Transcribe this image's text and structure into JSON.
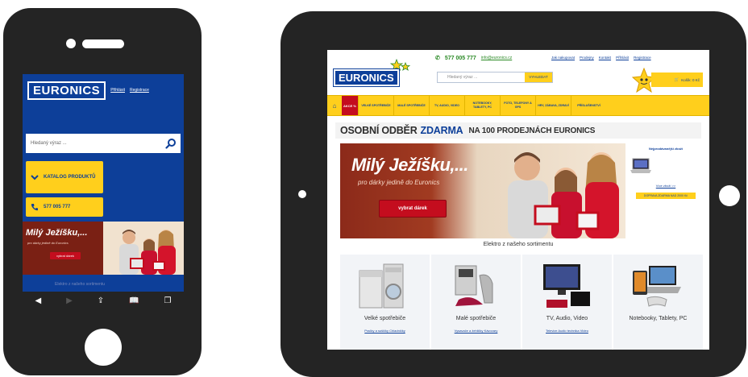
{
  "phone": {
    "logo": "EURONICS",
    "links": [
      "Přihlásit",
      "Registrace"
    ],
    "search_placeholder": "Hledaný výraz ...",
    "catalog_button": "KATALOG PRODUKTŮ",
    "phone_button": "577 005 777",
    "banner": {
      "title": "Milý Ježíšku,...",
      "subtitle": "pro dárky jedině do Euronics",
      "button": "vybrat dárek"
    },
    "blurred_footer": "Elektro z našeho sortimentu",
    "toolbar_icons": [
      "back-icon",
      "forward-icon",
      "share-icon",
      "bookmarks-icon",
      "tabs-icon"
    ]
  },
  "tablet": {
    "logo": "EURONICS",
    "phone": "577 005 777",
    "email": "info@euronics.cz",
    "top_links": [
      "Jak nakupovat",
      "Prodejny",
      "Kontakt",
      "Přihlásit",
      "Registrace"
    ],
    "search_placeholder": "Hledaný výraz ...",
    "search_button": "VYHLEDAT",
    "cart": "Košík: 0 Kč",
    "nav_sale": "AKCE %",
    "nav": [
      "VELKÉ SPOTŘEBIČE",
      "MALÉ SPOTŘEBIČE",
      "TV, AUDIO, VIDEO",
      "NOTEBOOKY, TABLETY, PC",
      "FOTO, TELEFONY A GPS",
      "HRY, ZÁBAVA, ZDRAVÍ",
      "PŘÍSLUŠENSTVÍ"
    ],
    "promo": {
      "lead": "OSOBNÍ ODBĚR",
      "highlight": "ZDARMA",
      "rest": "NA 100 PRODEJNÁCH EURONICS"
    },
    "hero": {
      "title": "Milý Ježíšku,...",
      "subtitle": "pro dárky jedině do Euronics",
      "button": "vybrat dárek"
    },
    "side": {
      "title": "Nejprodávanější zboží",
      "link": "Více zboží >>",
      "button": "DOPRAVA ZDARMA NAD 2000 Kč"
    },
    "range_title": "Elektro z našeho sortimentu",
    "categories": [
      {
        "label": "Velké spotřebiče",
        "sub": "Pračky a sušičky  Chladničky"
      },
      {
        "label": "Malé spotřebiče",
        "sub": "Vysavače a žehličky  Kávovary"
      },
      {
        "label": "TV, Audio, Video",
        "sub": "Televize  Audio technika  Video"
      },
      {
        "label": "Notebooky, Tablety, PC",
        "sub": ""
      }
    ]
  },
  "colors": {
    "brand_blue": "#0d3f99",
    "brand_yellow": "#ffcf1c",
    "accent_red": "#c40d1e",
    "device": "#242424"
  }
}
